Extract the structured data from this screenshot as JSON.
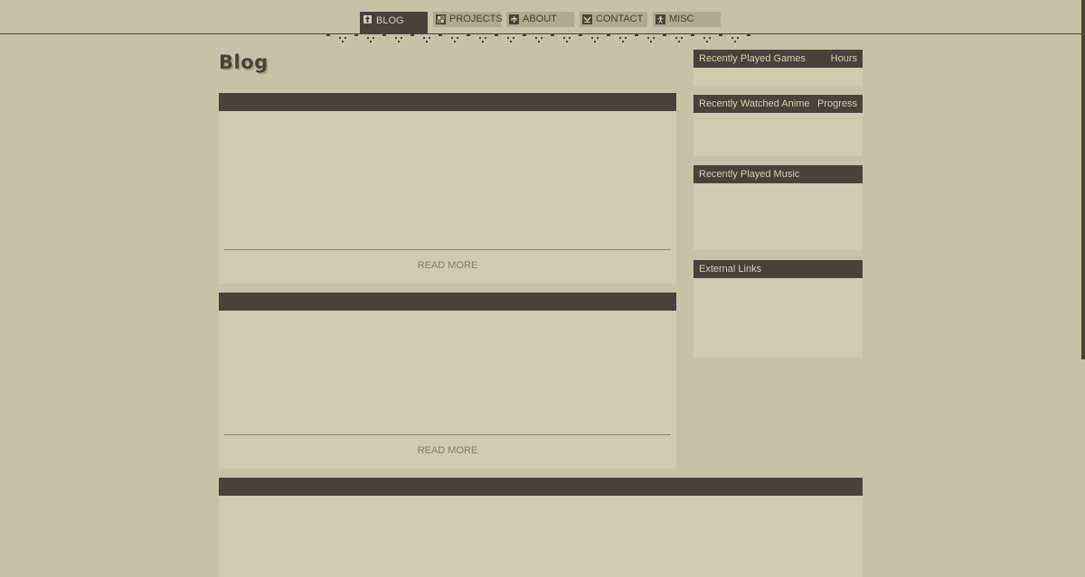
{
  "nav": {
    "items": [
      {
        "label": "BLOG",
        "icon": "up-arrow-icon",
        "active": true
      },
      {
        "label": "PROJECTS",
        "icon": "grid-icon",
        "active": false
      },
      {
        "label": "ABOUT",
        "icon": "person-icon",
        "active": false
      },
      {
        "label": "CONTACT",
        "icon": "envelope-icon",
        "active": false
      },
      {
        "label": "MISC",
        "icon": "figure-icon",
        "active": false
      }
    ]
  },
  "page": {
    "title": "Blog"
  },
  "posts": [
    {
      "read_more": "READ MORE"
    },
    {
      "read_more": "READ MORE"
    }
  ],
  "sidebar": {
    "games": {
      "title": "Recently Played Games",
      "aside": "Hours"
    },
    "anime": {
      "title": "Recently Watched Anime",
      "aside": "Progress"
    },
    "music": {
      "title": "Recently Played Music"
    },
    "links": {
      "title": "External Links"
    }
  },
  "colors": {
    "background": "#c7c2a7",
    "panel": "#cfcab0",
    "dark": "#47433a",
    "muted_text": "#857f6c"
  }
}
